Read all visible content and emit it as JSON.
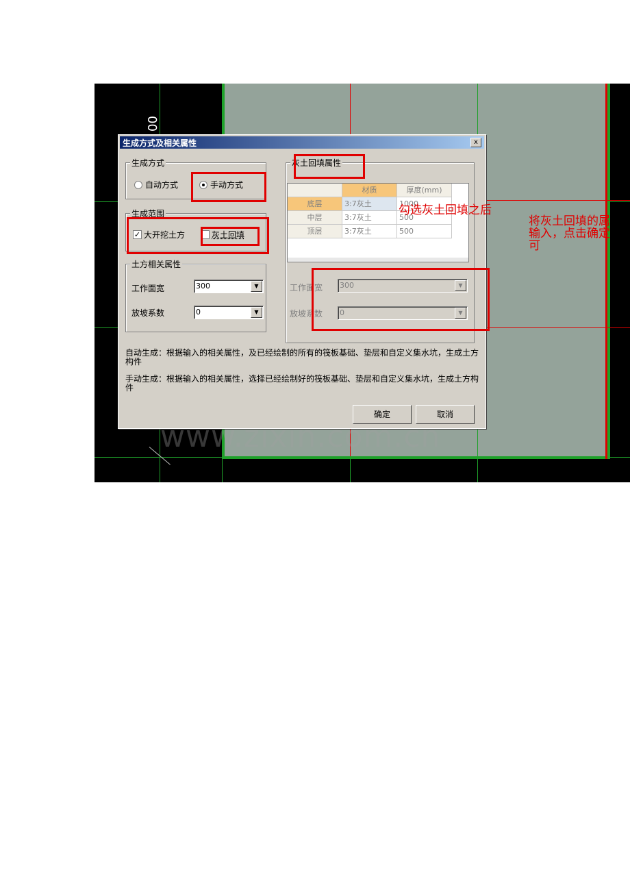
{
  "background": {
    "dimension_label": "00",
    "colors": {
      "cad_bg": "#000000",
      "slab": "#94a39a",
      "border": "#1fa12a",
      "axis": "#e00000",
      "grid": "#1fa12a"
    }
  },
  "dialog": {
    "title": "生成方式及相关属性",
    "close_label": "x",
    "mode_group": {
      "legend": "生成方式",
      "options": [
        {
          "label": "自动方式",
          "selected": false
        },
        {
          "label": "手动方式",
          "selected": true
        }
      ]
    },
    "range_group": {
      "legend": "生成范围",
      "options": [
        {
          "label": "大开挖土方",
          "checked": true,
          "check_mark": "✓"
        },
        {
          "label": "灰土回填",
          "checked": false,
          "check_mark": ""
        }
      ]
    },
    "earth_group": {
      "legend": "土方相关属性",
      "fields": [
        {
          "label": "工作面宽",
          "value": "300"
        },
        {
          "label": "放坡系数",
          "value": "0"
        }
      ]
    },
    "lime_group": {
      "legend": "灰土回填属性",
      "table": {
        "headers": [
          "",
          "材质",
          "厚度(mm)"
        ],
        "rows": [
          {
            "name": "底层",
            "material": "3:7灰土",
            "thickness": "1000"
          },
          {
            "name": "中层",
            "material": "3:7灰土",
            "thickness": "500"
          },
          {
            "name": "顶层",
            "material": "3:7灰土",
            "thickness": "500"
          }
        ]
      },
      "fields": [
        {
          "label": "工作面宽",
          "value": "300"
        },
        {
          "label": "放坡系数",
          "value": "0"
        }
      ]
    },
    "descriptions": [
      "自动生成：根据输入的相关属性，及已经绘制的所有的筏板基础、垫层和自定义集水坑，生成土方构件",
      "手动生成：根据输入的相关属性，选择已经绘制好的筏板基础、垫层和自定义集水坑，生成土方构件"
    ],
    "buttons": {
      "ok": "确定",
      "cancel": "取消"
    }
  },
  "annotations": {
    "after_check": "勾选灰土回填之后",
    "instruction_lines": [
      "将灰土回填的属",
      "输入，点击确定",
      "可"
    ],
    "color": "#e00000"
  },
  "watermark": "www.zixin.com.cn"
}
